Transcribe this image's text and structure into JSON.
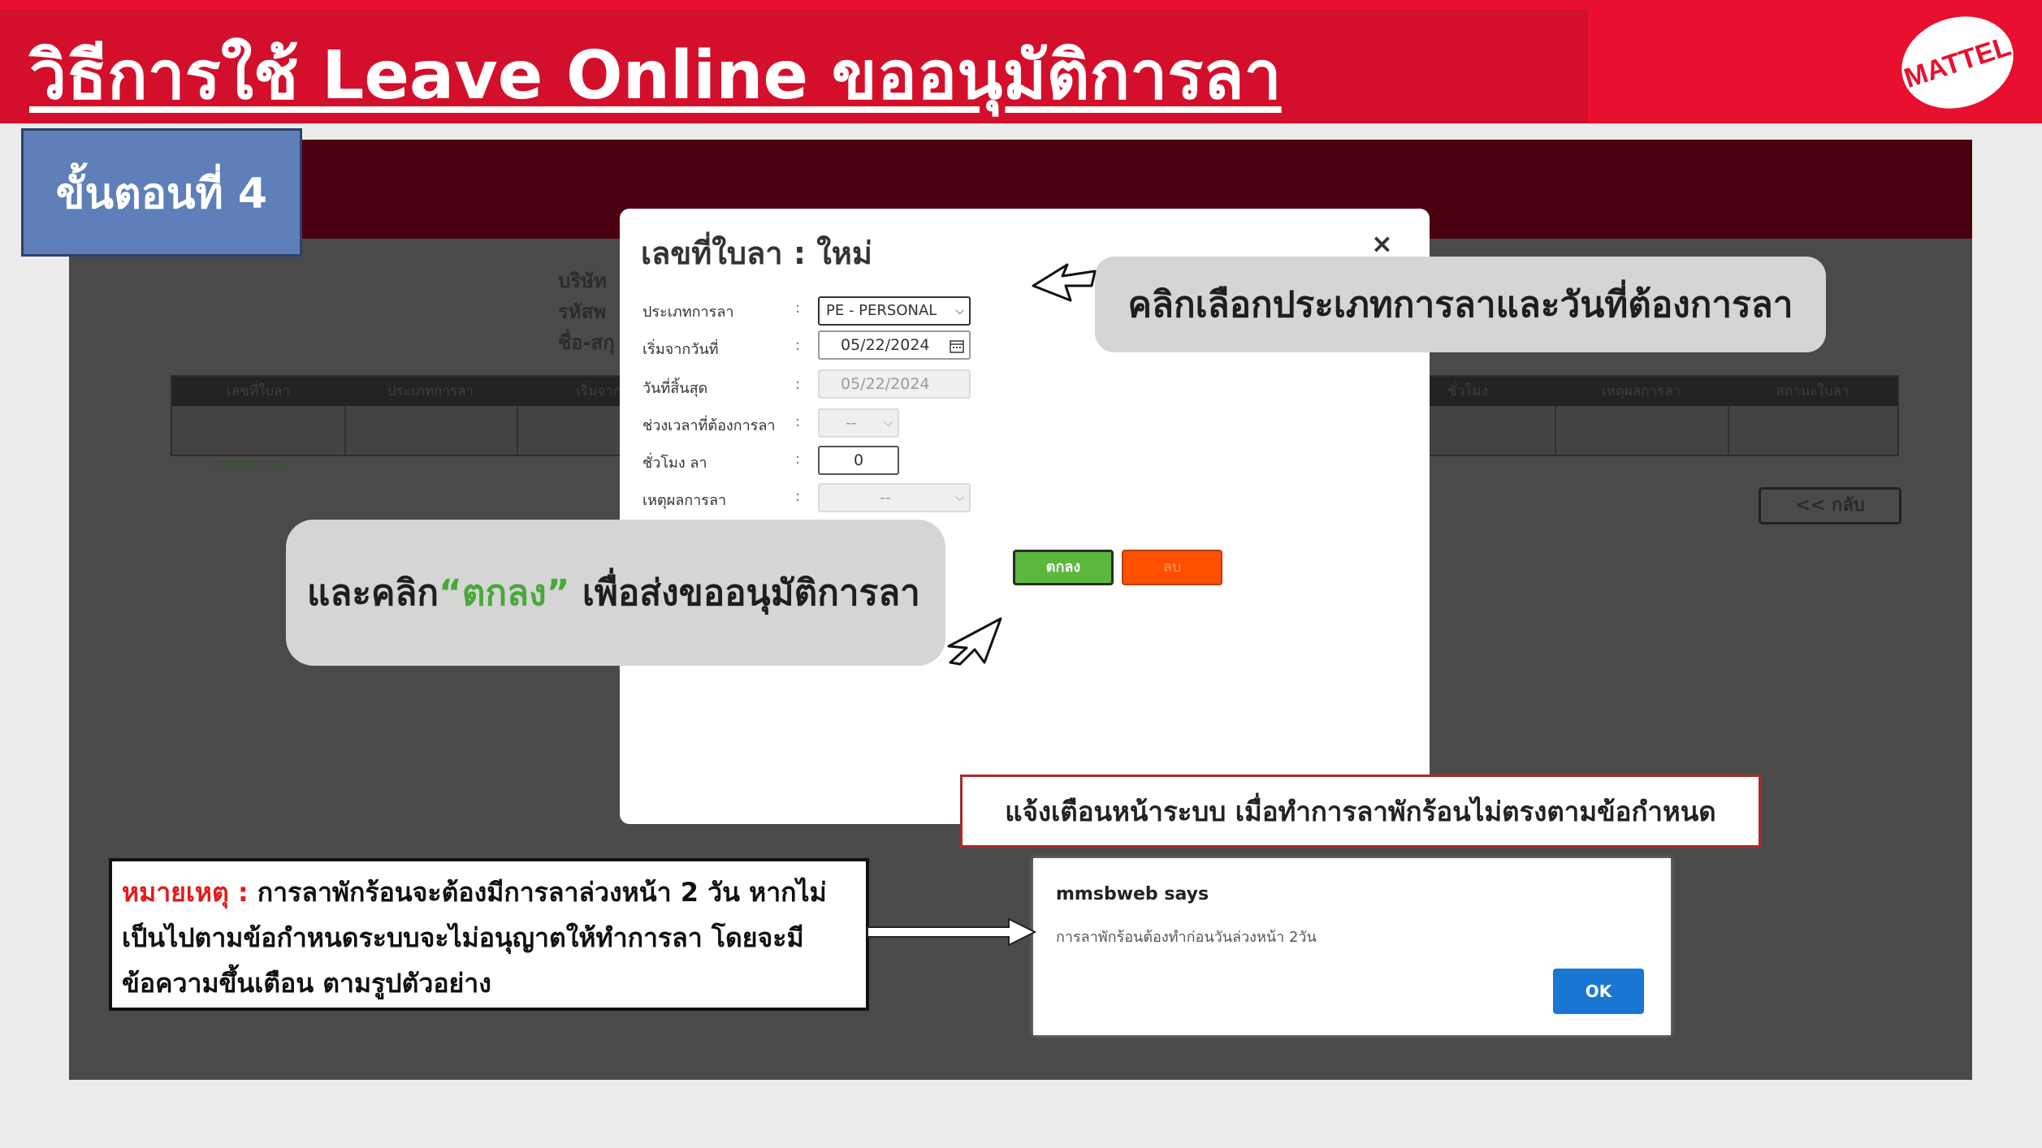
{
  "slide": {
    "title": "วิธีการใช้ Leave Online ขออนุมัติการลา",
    "logo_text": "MATTEL",
    "step_label": "ขั้นตอนที่ 4"
  },
  "background_app": {
    "info_labels": [
      "บริษัท",
      "รหัสพ",
      "ชื่อ-สกุ"
    ],
    "table_headers": [
      "เลขที่ใบลา",
      "ประเภทการลา",
      "เริ่มจากวั",
      "",
      "",
      "",
      "",
      "ชั่วโมง",
      "เหตุผลการลา",
      "สถานะใบลา"
    ],
    "status_cell": "การขอลางาน",
    "back_button": "<< กลับ"
  },
  "modal": {
    "title": "เลขที่ใบลา : ใหม่",
    "close": "×",
    "fields": {
      "leave_type": {
        "label": "ประเภทการลา",
        "value": "PE - PERSONAL"
      },
      "start_date": {
        "label": "เริ่มจากวันที่",
        "value": "05/22/2024"
      },
      "end_date": {
        "label": "วันที่สิ้นสุด",
        "value": "05/22/2024"
      },
      "time_period": {
        "label": "ช่วงเวลาที่ต้องการลา",
        "value": "--"
      },
      "hours": {
        "label": "ชั่วโมง ลา",
        "value": "0"
      },
      "reason": {
        "label": "เหตุผลการลา",
        "value": "--"
      }
    },
    "colon": ":",
    "ok_button": "ตกลง",
    "delete_button": "ลบ"
  },
  "callouts": {
    "select_type": "คลิกเลือกประเภทการลาและวันที่ต้องการลา",
    "confirm_prefix": "และคลิก",
    "confirm_quote": "“ตกลง”",
    "confirm_suffix": " เพื่อส่งขออนุมัติการลา"
  },
  "warning_caption": "แจ้งเตือนหน้าระบบ เมื่อทำการลาพักร้อนไม่ตรงตามข้อกำหนด",
  "alert": {
    "title": "mmsbweb says",
    "message": "การลาพักร้อนต้องทำก่อนวันล่วงหน้า 2วัน",
    "ok": "OK"
  },
  "note": {
    "label": "หมายเหตุ :",
    "text": " การลาพักร้อนจะต้องมีการลาล่วงหน้า 2 วัน หากไม่เป็นไปตามข้อกำหนดระบบจะไม่อนุญาตให้ทำการลา โดยจะมีข้อความขึ้นเตือน ตามรูปตัวอย่าง"
  },
  "colors": {
    "banner": "#e8102e",
    "step_badge": "#5e7fb8",
    "ok_green": "#5ab83c",
    "delete_orange": "#ff4f00",
    "alert_ok_blue": "#1976d2",
    "note_label_red": "#e21b1b"
  }
}
